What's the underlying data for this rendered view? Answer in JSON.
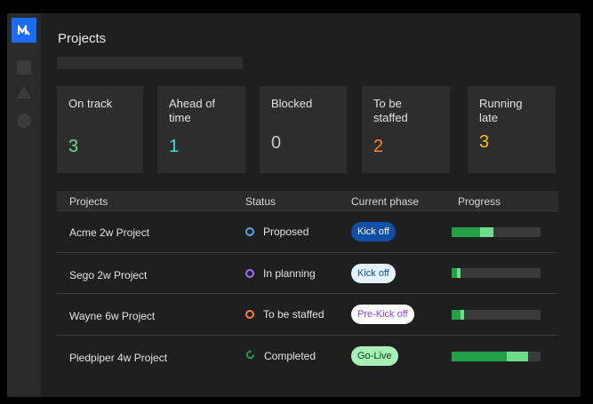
{
  "page": {
    "title": "Projects"
  },
  "sidebar": {
    "logo_text": "M"
  },
  "summary": [
    {
      "label": "On track",
      "value": "3",
      "color": "#6fdc8c"
    },
    {
      "label": "Ahead of time",
      "value": "1",
      "color": "#3ddbd9"
    },
    {
      "label": "Blocked",
      "value": "0",
      "color": "#c6c6c6"
    },
    {
      "label": "To be staffed",
      "value": "2",
      "color": "#ff832b"
    },
    {
      "label": "Running late",
      "value": "3",
      "color": "#f1c21b"
    }
  ],
  "table": {
    "headers": {
      "projects": "Projects",
      "status": "Status",
      "phase": "Current phase",
      "progress": "Progress"
    },
    "rows": [
      {
        "name": "Acme 2w Project",
        "status": "Proposed",
        "status_color": "#5aa6e6",
        "status_icon": "circle-icon",
        "phase": "Kick off",
        "phase_bg": "#0f4fa8",
        "phase_fg": "#ffffff",
        "progress_a": 0.32,
        "progress_b": 0.15
      },
      {
        "name": "Sego 2w Project",
        "status": "In planning",
        "status_color": "#a56eff",
        "status_icon": "circle-icon",
        "phase": "Kick off",
        "phase_bg": "#e5f2ff",
        "phase_fg": "#0f4fa8",
        "progress_a": 0.06,
        "progress_b": 0.04
      },
      {
        "name": "Wayne 6w Project",
        "status": "To be staffed",
        "status_color": "#ff832b",
        "status_icon": "circle-icon",
        "phase": "Pre-Kick off",
        "phase_bg": "#ffffff",
        "phase_fg": "#8a3ffc",
        "progress_a": 0.1,
        "progress_b": 0.04
      },
      {
        "name": "Piedpiper 4w Project",
        "status": "Completed",
        "status_color": "#24a148",
        "status_icon": "refresh-icon",
        "phase": "Go-Live",
        "phase_bg": "#a7f0ba",
        "phase_fg": "#044317",
        "progress_a": 0.62,
        "progress_b": 0.24
      }
    ]
  }
}
